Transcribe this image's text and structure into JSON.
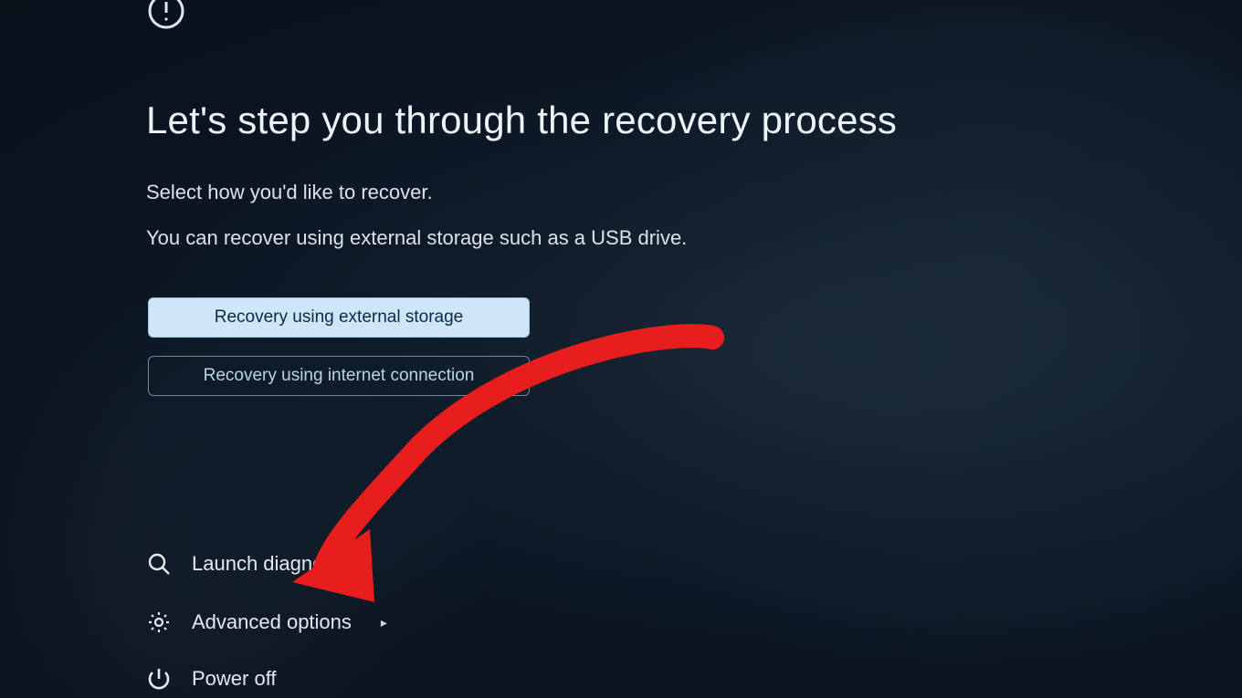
{
  "header": {
    "title": "Let's step you through the recovery process",
    "subtitle_line1": "Select how you'd like to recover.",
    "subtitle_line2": "You can recover using external storage such as a USB drive."
  },
  "buttons": {
    "external_storage": "Recovery using external storage",
    "internet_connection": "Recovery using internet connection"
  },
  "actions": {
    "diagnostics_label": "Launch diagnostics",
    "advanced_label": "Advanced options",
    "power_off_label": "Power off"
  },
  "annotation": {
    "arrow_color": "#e81e1e",
    "target": "advanced-options"
  }
}
